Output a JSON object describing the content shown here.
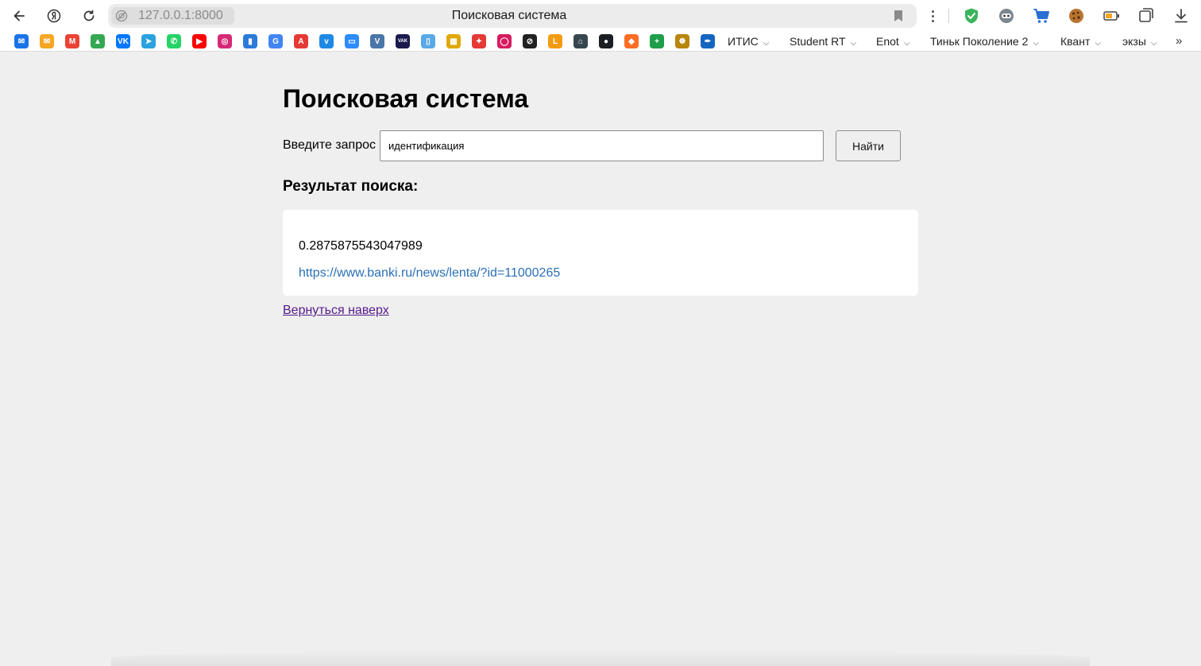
{
  "browser": {
    "url": "127.0.0.1:8000",
    "tab_title": "Поисковая система",
    "bookmark_folders": [
      {
        "label": "ИТИС"
      },
      {
        "label": "Student RT"
      },
      {
        "label": "Enot"
      },
      {
        "label": "Тиньк Поколение 2"
      },
      {
        "label": "Квант"
      },
      {
        "label": "экзы"
      }
    ],
    "bookmark_icons": [
      {
        "name": "mail-icon",
        "color": "#1a73e8",
        "glyph": "✉"
      },
      {
        "name": "yandex-mail-icon",
        "color": "#f5a623",
        "glyph": "✉"
      },
      {
        "name": "gmail-icon",
        "color": "#ea4335",
        "glyph": "M"
      },
      {
        "name": "google-drive-icon",
        "color": "#34a853",
        "glyph": "▲"
      },
      {
        "name": "vk-icon",
        "color": "#0077ff",
        "glyph": "VK"
      },
      {
        "name": "telegram-icon",
        "color": "#2aa3df",
        "glyph": "➤"
      },
      {
        "name": "whatsapp-icon",
        "color": "#25d366",
        "glyph": "✆"
      },
      {
        "name": "youtube-icon",
        "color": "#ff0000",
        "glyph": "▶"
      },
      {
        "name": "instagram-icon",
        "color": "#d62976",
        "glyph": "◎"
      },
      {
        "name": "stats-icon",
        "color": "#2b7bd9",
        "glyph": "▮"
      },
      {
        "name": "translate-icon",
        "color": "#4285f4",
        "glyph": "G"
      },
      {
        "name": "lingq-icon",
        "color": "#e53935",
        "glyph": "A"
      },
      {
        "name": "vimeo-icon",
        "color": "#1e88e5",
        "glyph": "v"
      },
      {
        "name": "zoom-icon",
        "color": "#2d8cff",
        "glyph": "▭"
      },
      {
        "name": "vk-video-icon",
        "color": "#4a76a8",
        "glyph": "V"
      },
      {
        "name": "vak-icon",
        "color": "#1a1a4e",
        "glyph": "VAK"
      },
      {
        "name": "bottle-icon",
        "color": "#5aa9e6",
        "glyph": "▯"
      },
      {
        "name": "table-icon",
        "color": "#e0a800",
        "glyph": "▦"
      },
      {
        "name": "star-app-icon",
        "color": "#e53935",
        "glyph": "✦"
      },
      {
        "name": "ring-app-icon",
        "color": "#d81b60",
        "glyph": "◯"
      },
      {
        "name": "link-icon",
        "color": "#222222",
        "glyph": "⊘"
      },
      {
        "name": "lms-icon",
        "color": "#f39c12",
        "glyph": "L"
      },
      {
        "name": "bank-icon",
        "color": "#37474f",
        "glyph": "⌂"
      },
      {
        "name": "github-icon",
        "color": "#1b1f23",
        "glyph": "●"
      },
      {
        "name": "gitlab-icon",
        "color": "#fc6d26",
        "glyph": "◆"
      },
      {
        "name": "plus-icon",
        "color": "#1e9e4a",
        "glyph": "+"
      },
      {
        "name": "emblem-icon",
        "color": "#b8860b",
        "glyph": "☸"
      },
      {
        "name": "fountain-pen-icon",
        "color": "#1565c0",
        "glyph": "✒"
      }
    ]
  },
  "page": {
    "title": "Поисковая система",
    "search_label": "Введите запрос",
    "search_value": "идентификация",
    "search_button": "Найти",
    "results_heading": "Результат поиска:",
    "results": [
      {
        "score": "0.2875875543047989",
        "url": "https://www.banki.ru/news/lenta/?id=11000265"
      }
    ],
    "back_to_top": "Вернуться наверх"
  }
}
